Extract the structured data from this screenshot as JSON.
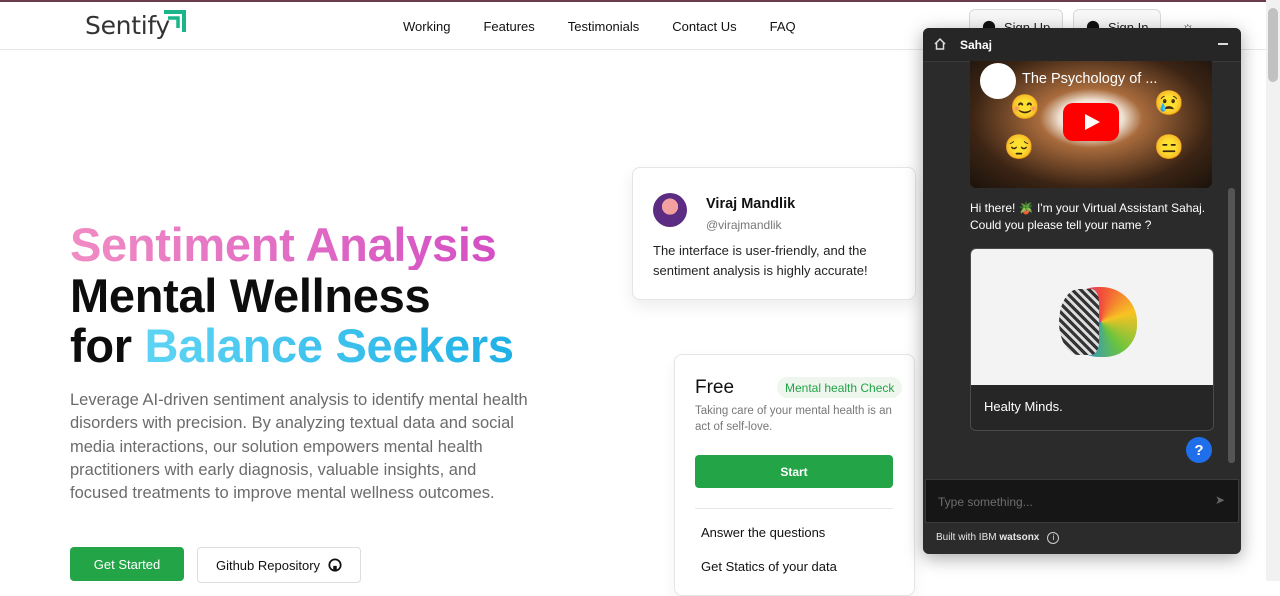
{
  "brand": {
    "name": "Sentify"
  },
  "nav": {
    "links": [
      "Working",
      "Features",
      "Testimonials",
      "Contact Us",
      "FAQ"
    ],
    "signup": "Sign Up",
    "signin": "Sign In"
  },
  "hero": {
    "line1": "Sentiment Analysis",
    "line2": "Mental Wellness",
    "line3_a": "for ",
    "line3_b": "Balance Seekers",
    "description": "Leverage AI-driven sentiment analysis to identify mental health disorders with precision. By analyzing textual data and social media interactions, our solution empowers mental health practitioners with early diagnosis, valuable insights, and focused treatments to improve mental wellness outcomes.",
    "get_started": "Get Started",
    "github": "Github Repository"
  },
  "testimonial": {
    "name": "Viraj Mandlik",
    "handle": "@virajmandlik",
    "quote": "The interface is user-friendly, and the sentiment analysis is highly accurate!"
  },
  "pricing": {
    "plan": "Free",
    "badge": "Mental health Check",
    "description": "Taking care of your mental health is an act of self-love.",
    "start": "Start",
    "features": [
      "Answer the questions",
      "Get Statics of your data"
    ]
  },
  "chat": {
    "title": "Sahaj",
    "video_title": "The Psychology of ...",
    "greeting": "Hi there! 🪴 I'm your Virtual Assistant Sahaj. Could you please tell your name ?",
    "card_label": "Healty Minds.",
    "help": "?",
    "placeholder": "Type something...",
    "footer_prefix": "Built with IBM ",
    "footer_brand": "watsonx"
  },
  "colors": {
    "accent_green": "#22a447",
    "chat_bg": "#2b2b2b",
    "help_blue": "#1f6feb"
  }
}
